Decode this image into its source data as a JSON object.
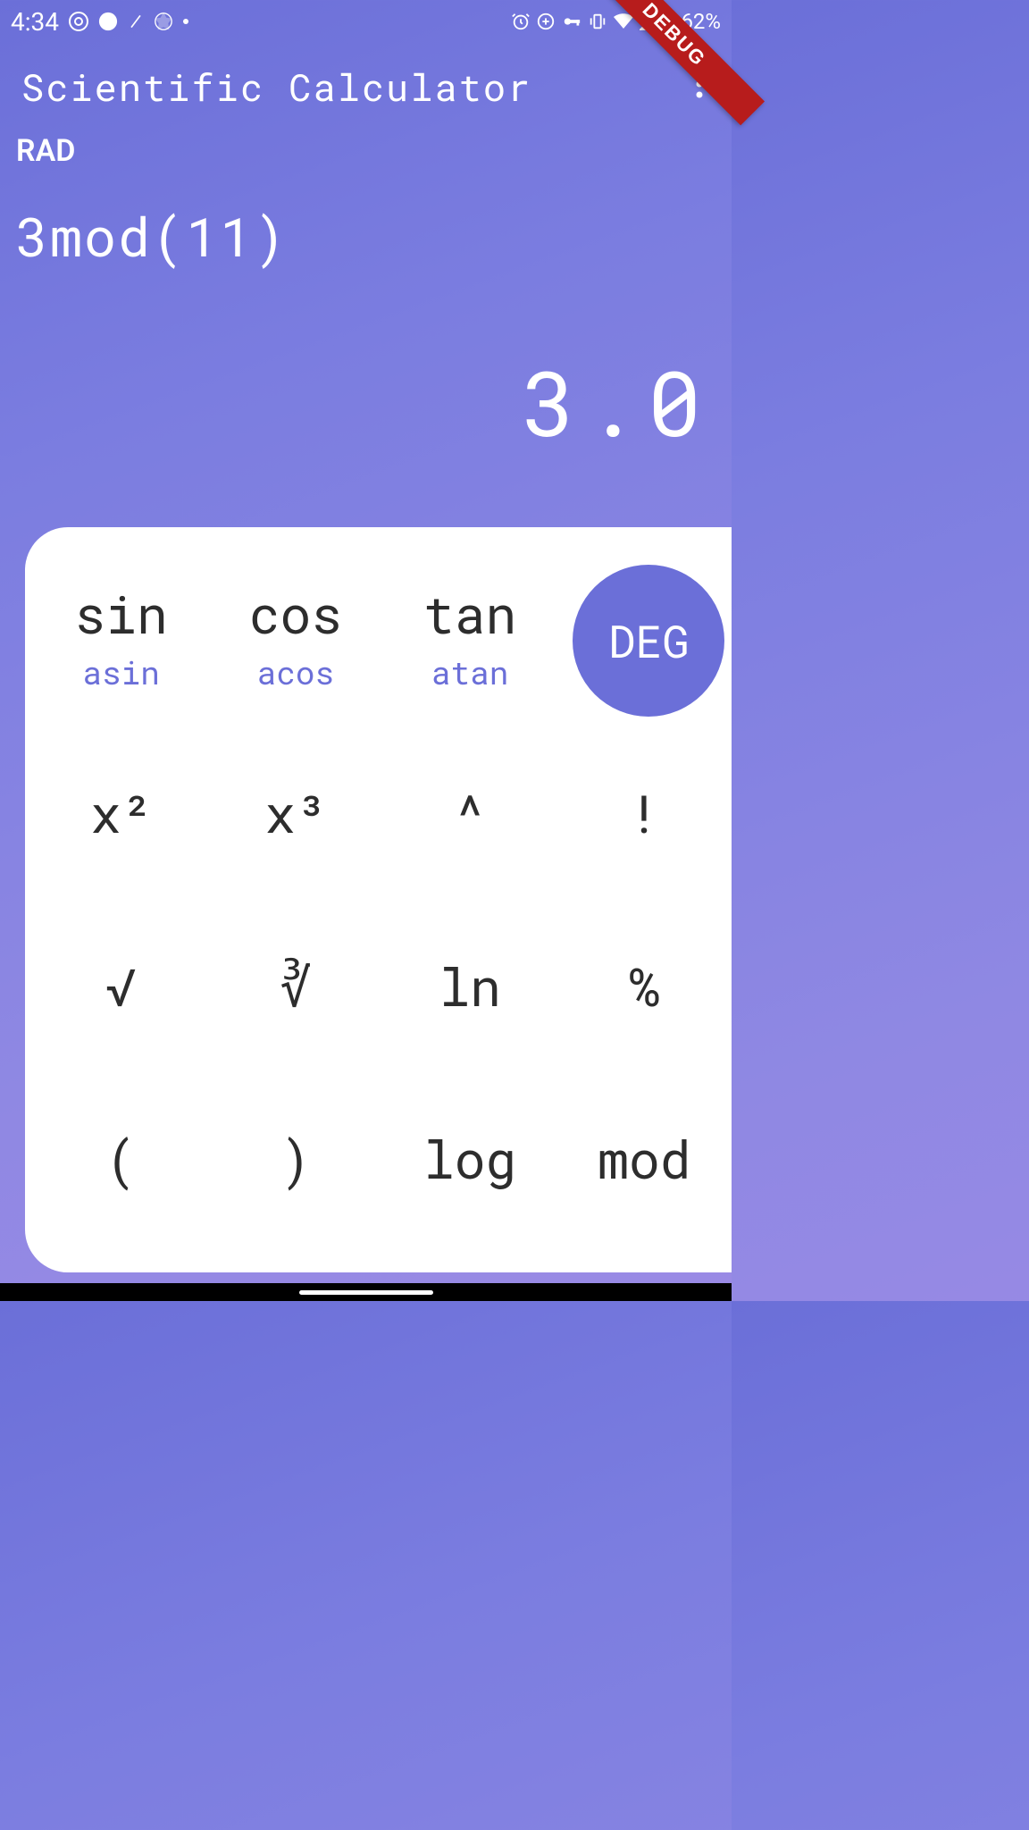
{
  "status": {
    "time": "4:34",
    "battery": "62%"
  },
  "debug_label": "DEBUG",
  "app_title": "Scientific Calculator",
  "mode_label": "RAD",
  "expression": "3mod(11)",
  "result": "3.0",
  "keys": {
    "sin": {
      "main": "sin",
      "sub": "asin"
    },
    "cos": {
      "main": "cos",
      "sub": "acos"
    },
    "tan": {
      "main": "tan",
      "sub": "atan"
    },
    "deg": "DEG",
    "x2": "x²",
    "x3": "x³",
    "pow": "^",
    "fact": "!",
    "sqrt": "√",
    "cbrt": "∛",
    "ln": "ln",
    "pct": "%",
    "lparen": "(",
    "rparen": ")",
    "log": "log",
    "mod": "mod"
  }
}
